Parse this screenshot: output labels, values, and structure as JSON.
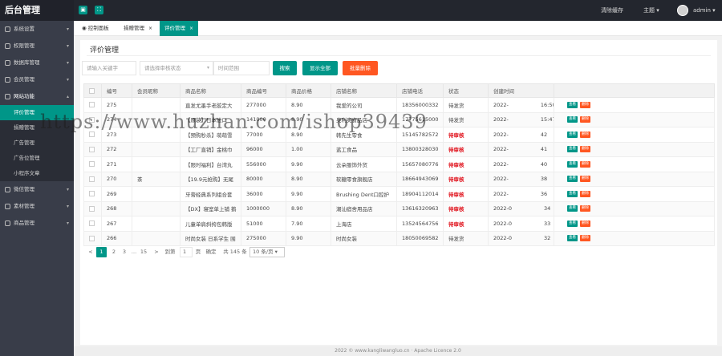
{
  "header": {
    "logo": "后台管理",
    "left_buttons": [
      "▣",
      "⛶"
    ],
    "clear_cache": "清除缓存",
    "theme": "主题",
    "user": "admin"
  },
  "sidebar": {
    "items": [
      {
        "label": "系统设置"
      },
      {
        "label": "权限管理"
      },
      {
        "label": "数据库管理"
      },
      {
        "label": "会员管理"
      },
      {
        "label": "网站功能"
      },
      {
        "label": "微信管理"
      },
      {
        "label": "素材管理"
      },
      {
        "label": "商品管理"
      }
    ],
    "subitems": [
      "评价管理",
      "捐赠管理",
      "广告管理",
      "广告位管理",
      "小程序文章"
    ]
  },
  "tabs": [
    {
      "label": "控制面板"
    },
    {
      "label": "捐赠管理"
    },
    {
      "label": "评价管理"
    }
  ],
  "page": {
    "title": "评价管理",
    "filter": {
      "keyword_placeholder": "请输入关键字",
      "status_placeholder": "请选择审核状态",
      "time_placeholder": "时间范围",
      "search_label": "搜索",
      "show_all_label": "显示全部",
      "batch_delete_label": "批量删除"
    }
  },
  "table": {
    "columns": [
      "",
      "编号",
      "会员昵称",
      "商品名称",
      "商品编号",
      "商品价格",
      "店铺名称",
      "店铺电话",
      "状态",
      "创建时间",
      ""
    ],
    "rows": [
      {
        "id": "275",
        "member": "",
        "product": "直发尤墨手老胶定大",
        "code": "277000",
        "price": "8.90",
        "shop": "我爱的公司",
        "phone": "18356000332",
        "status": "待发货",
        "pending": false,
        "time": "2022-",
        "time_tail": "16:50"
      },
      {
        "id": "274",
        "member": "",
        "product": "【原装】日本进口",
        "code": "141000",
        "price": "8.90",
        "shop": "奥利奥食品店",
        "phone": "17775615000",
        "status": "待发货",
        "pending": false,
        "time": "2022-",
        "time_tail": "15:47"
      },
      {
        "id": "273",
        "member": "",
        "product": "【预购秒杀】萌萌雪",
        "code": "77000",
        "price": "8.90",
        "shop": "韩先生零食",
        "phone": "15145782572",
        "status": "待审核",
        "pending": true,
        "time": "2022-",
        "time_tail": "42"
      },
      {
        "id": "272",
        "member": "",
        "product": "【工厂直销】金桃巾",
        "code": "96000",
        "price": "1.00",
        "shop": "蓝工食品",
        "phone": "13800328030",
        "status": "待审核",
        "pending": true,
        "time": "2022-",
        "time_tail": "41"
      },
      {
        "id": "271",
        "member": "",
        "product": "【限时福利】台湾丸",
        "code": "556000",
        "price": "9.90",
        "shop": "云朵服饰外贸",
        "phone": "15657080776",
        "status": "待审核",
        "pending": true,
        "time": "2022-",
        "time_tail": "40"
      },
      {
        "id": "270",
        "member": "茶",
        "product": "【19.9元抢购】无尾",
        "code": "80000",
        "price": "8.90",
        "shop": "软糖零食旗舰店",
        "phone": "18664943069",
        "status": "待审核",
        "pending": true,
        "time": "2022-",
        "time_tail": "38"
      },
      {
        "id": "269",
        "member": "",
        "product": "牙膏经典系列组合套",
        "code": "36000",
        "price": "9.90",
        "shop": "Brushing Dent口腔护",
        "phone": "18904112014",
        "status": "待审核",
        "pending": true,
        "time": "2022-",
        "time_tail": "36"
      },
      {
        "id": "268",
        "member": "",
        "product": "【DX】寝室单上铺 鹅",
        "code": "1000000",
        "price": "8.90",
        "shop": "潮汕宿舍用品店",
        "phone": "13616320963",
        "status": "待审核",
        "pending": true,
        "time": "2022-0",
        "time_tail": "34"
      },
      {
        "id": "267",
        "member": "",
        "product": "儿童单肩斜挎包韩版",
        "code": "51000",
        "price": "7.90",
        "shop": "上海店",
        "phone": "13524564756",
        "status": "待审核",
        "pending": true,
        "time": "2022-0",
        "time_tail": "33"
      },
      {
        "id": "266",
        "member": "",
        "product": "时尚女装 日系学生 围",
        "code": "275000",
        "price": "9.90",
        "shop": "时尚女装",
        "phone": "18050069582",
        "status": "待发货",
        "pending": false,
        "time": "2022-0",
        "time_tail": "32"
      }
    ],
    "view_label": "查看",
    "delete_label": "删除"
  },
  "pager": {
    "pages": [
      "1",
      "2",
      "3",
      "…",
      "15"
    ],
    "goto": "到第",
    "goto_value": "1",
    "page_unit": "页",
    "confirm": "确定",
    "total": "共 145 条",
    "per_page": "10 条/页",
    "prev": "<",
    "next": ">"
  },
  "footer": {
    "text": "2022 © www.kangliwangluo.cn · Apache Licence 2.0"
  },
  "watermark": "https://www.huzhan.com/ishop39439",
  "colors": {
    "header_bg": "#23262e",
    "sidebar_bg": "#393d49",
    "accent": "#009688",
    "danger": "#ff5722",
    "pending_text": "#e0101a"
  }
}
